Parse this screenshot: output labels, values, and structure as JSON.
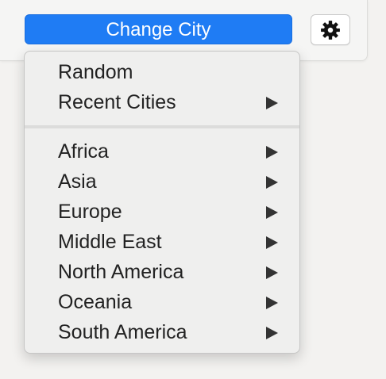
{
  "toolbar": {
    "change_city_label": "Change City",
    "accent_color": "#1f7cf4",
    "settings_icon": "gear-icon"
  },
  "menu": {
    "top_items": [
      {
        "label": "Random",
        "has_submenu": false
      },
      {
        "label": "Recent Cities",
        "has_submenu": true
      }
    ],
    "region_items": [
      {
        "label": "Africa",
        "has_submenu": true
      },
      {
        "label": "Asia",
        "has_submenu": true
      },
      {
        "label": "Europe",
        "has_submenu": true
      },
      {
        "label": "Middle East",
        "has_submenu": true
      },
      {
        "label": "North America",
        "has_submenu": true
      },
      {
        "label": "Oceania",
        "has_submenu": true
      },
      {
        "label": "South America",
        "has_submenu": true
      }
    ],
    "submenu_icon": "chevron-right-icon"
  }
}
